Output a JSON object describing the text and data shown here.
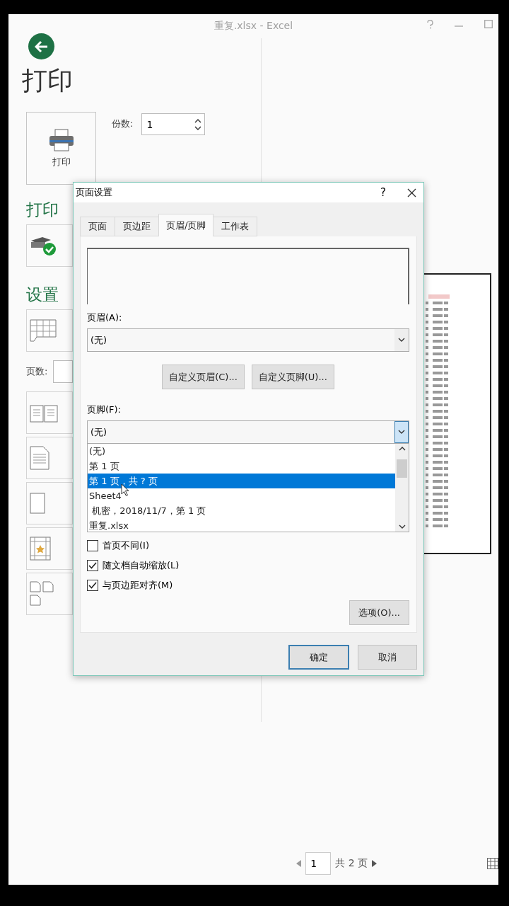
{
  "window": {
    "title": "重复.xlsx - Excel"
  },
  "heading": "打印",
  "print_button": {
    "label": "打印"
  },
  "copies": {
    "label": "份数:",
    "value": "1"
  },
  "printer_heading": "打印",
  "settings_heading": "设置",
  "pages_label": "页数:",
  "dialog": {
    "title": "页面设置",
    "help": "?",
    "tabs": [
      {
        "label": "页面",
        "selected": false
      },
      {
        "label": "页边距",
        "selected": false
      },
      {
        "label": "页眉/页脚",
        "selected": true
      },
      {
        "label": "工作表",
        "selected": false
      }
    ],
    "header_label": "页眉(A):",
    "header_value": "(无)",
    "custom_buttons": [
      "自定义页眉(C)...",
      "自定义页脚(U)..."
    ],
    "footer_label": "页脚(F):",
    "footer_value": "(无)",
    "footer_options": [
      {
        "label": "(无)",
        "selected": false
      },
      {
        "label": "第 1 页",
        "selected": false
      },
      {
        "label": "第 1 页，共 ? 页",
        "selected": true
      },
      {
        "label": "Sheet4",
        "selected": false
      },
      {
        "label": " 机密，2018/11/7，第 1 页",
        "selected": false
      },
      {
        "label": "重复.xlsx",
        "selected": false
      }
    ],
    "checkboxes": [
      {
        "label": "首页不同(I)",
        "checked": false
      },
      {
        "label": "随文档自动缩放(L)",
        "checked": true
      },
      {
        "label": "与页边距对齐(M)",
        "checked": true
      }
    ],
    "options_button": "选项(O)...",
    "ok_button": "确定",
    "cancel_button": "取消"
  },
  "page_nav": {
    "current": "1",
    "total": "共 2 页"
  }
}
